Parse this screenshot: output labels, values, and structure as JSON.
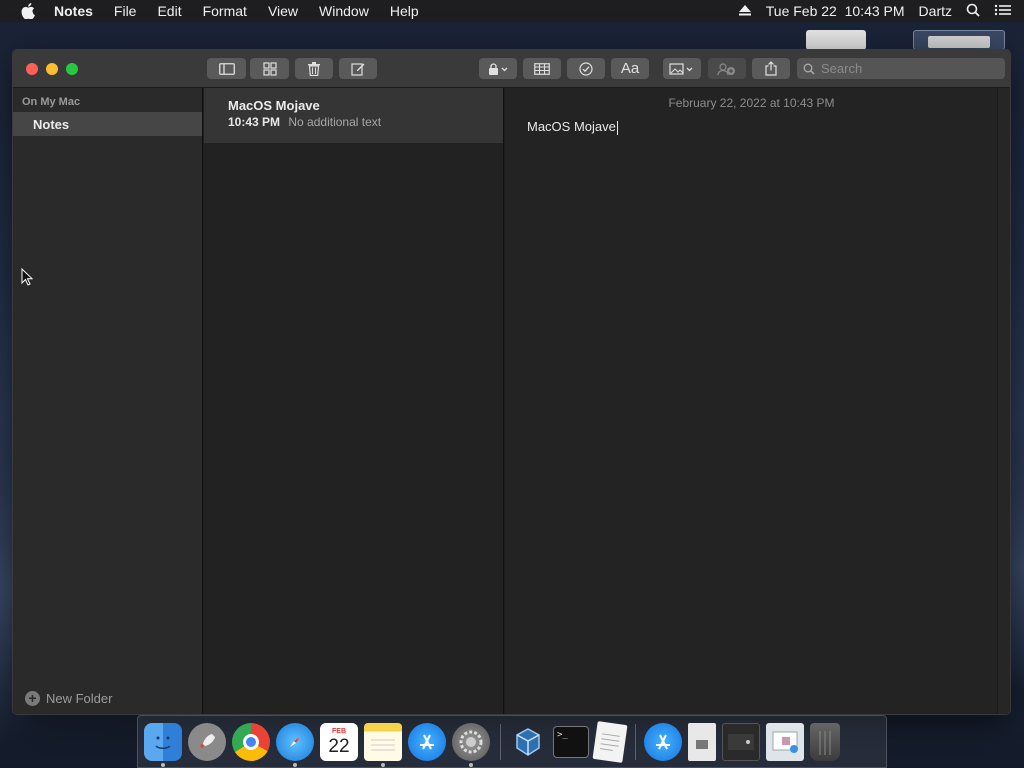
{
  "menubar": {
    "app_name": "Notes",
    "menus": [
      "File",
      "Edit",
      "Format",
      "View",
      "Window",
      "Help"
    ],
    "clock": "Tue Feb 22  10:43 PM",
    "user": "Dartz"
  },
  "toolbar": {
    "search_placeholder": "Search",
    "format_label": "Aa"
  },
  "sidebar": {
    "section_title": "On My Mac",
    "folders": [
      {
        "label": "Notes"
      }
    ],
    "new_folder_label": "New Folder"
  },
  "note_list": {
    "items": [
      {
        "title": "MacOS Mojave",
        "time": "10:43 PM",
        "preview": "No additional text"
      }
    ]
  },
  "editor": {
    "date": "February 22, 2022 at 10:43 PM",
    "content": "MacOS Mojave"
  },
  "dock": {
    "apps": [
      "finder-icon",
      "launchpad-icon",
      "chrome-icon",
      "safari-icon",
      "calendar-icon",
      "notes-icon",
      "app-store-icon",
      "system-preferences-icon",
      "virtualbox-icon",
      "terminal-icon",
      "textedit-icon",
      "app-store-downloads-icon",
      "file-icon",
      "screenshot-icon",
      "preview-icon",
      "trash-icon"
    ],
    "calendar_month": "FEB",
    "calendar_day": "22"
  }
}
